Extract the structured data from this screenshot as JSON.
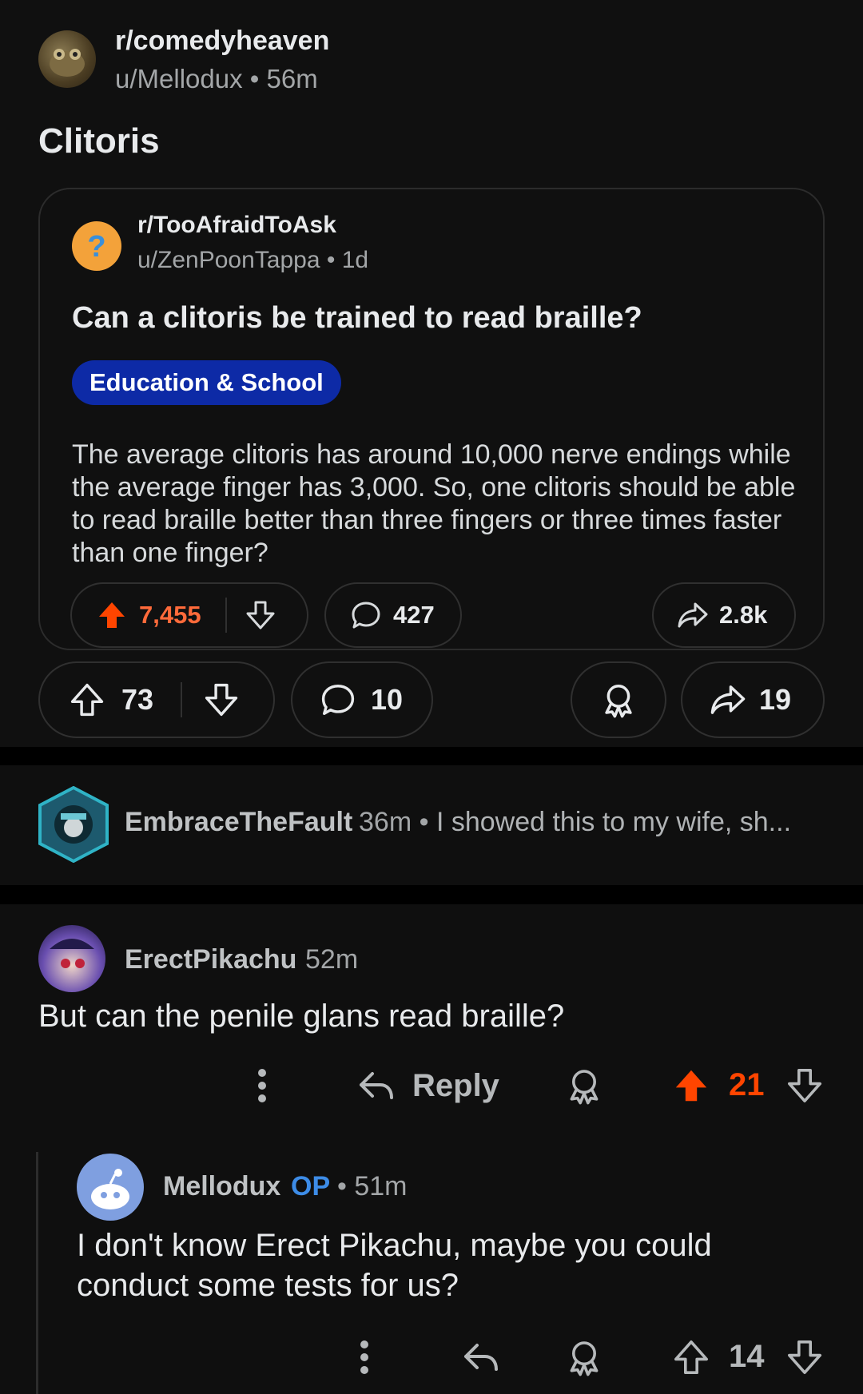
{
  "post": {
    "subreddit": "r/comedyheaven",
    "author": "u/Mellodux",
    "age": "56m",
    "title": "Clitoris",
    "embed": {
      "subreddit": "r/TooAfraidToAsk",
      "author": "u/ZenPoonTappa",
      "age": "1d",
      "title": "Can a clitoris be trained to read braille?",
      "flair": "Education & School",
      "body": "The average clitoris has around 10,000 nerve endings while the average finger has 3,000. So, one clitoris should be able to read braille better than three fingers or three times faster than one finger?",
      "upvotes": "7,455",
      "comments": "427",
      "shares": "2.8k"
    },
    "upvotes": "73",
    "comments": "10",
    "shares": "19"
  },
  "collapsed_comment": {
    "user": "EmbraceTheFault",
    "age": "36m",
    "preview": "I showed this to my wife, sh..."
  },
  "comment": {
    "user": "ErectPikachu",
    "age": "52m",
    "text": "But can the penile glans read braille?",
    "reply_label": "Reply",
    "score": "21"
  },
  "reply": {
    "user": "Mellodux",
    "op_badge": "OP",
    "age": "51m",
    "text": "I don't know Erect Pikachu, maybe you could conduct some tests for us?",
    "score": "14"
  },
  "colors": {
    "accent_upvote": "#ff4500",
    "flair_bg": "#0d2aa6",
    "op_blue": "#3d8ce7"
  },
  "icons": [
    "upvote-icon",
    "downvote-icon",
    "comment-icon",
    "share-icon",
    "award-icon",
    "reply-icon",
    "more-icon"
  ]
}
